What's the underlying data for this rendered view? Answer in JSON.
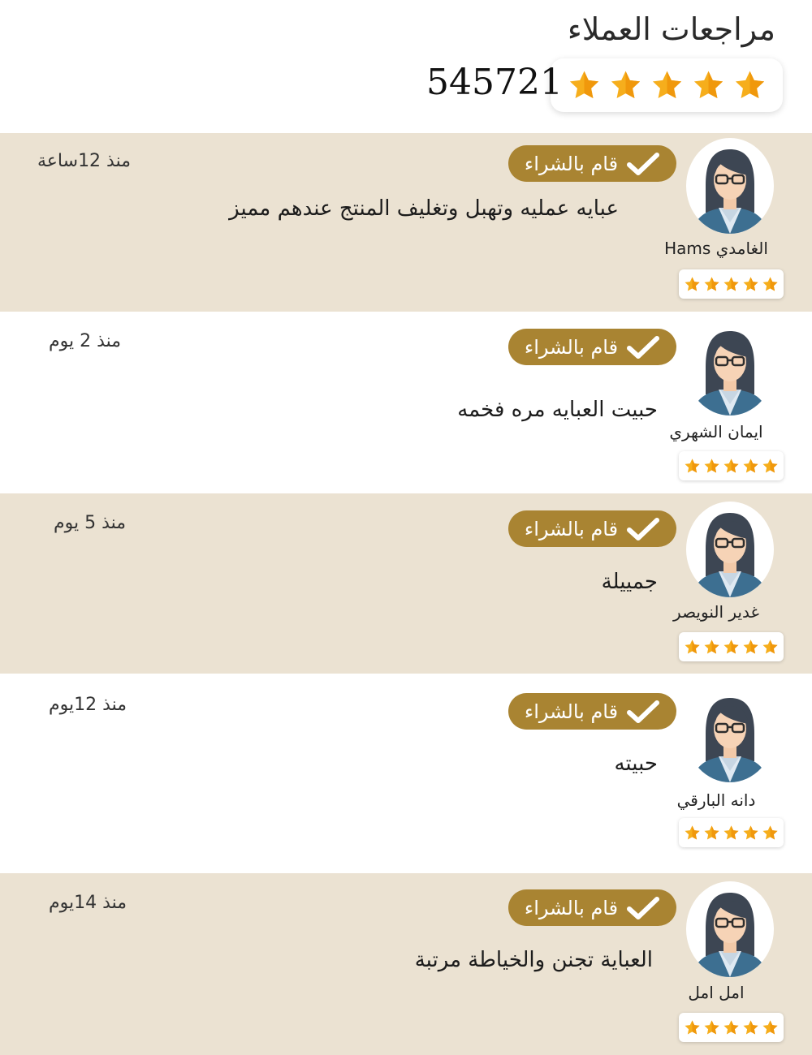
{
  "header": {
    "title": "مراجعات العملاء",
    "total_reviews": "545721",
    "overall_stars": 5
  },
  "colors": {
    "badge": "#a98432",
    "tint": "#ebe2d2",
    "star": "#f6ae1c"
  },
  "badge_label": "قام بالشراء",
  "reviews": [
    {
      "name": "الغامدي Hams",
      "text": "عبايه عمليه وتهبل وتغليف المنتج عندهم مميز",
      "time": "منذ 12ساعة",
      "stars": 5
    },
    {
      "name": "ايمان الشهري",
      "text": "حبيت العبايه مره فخمه",
      "time": "منذ 2 يوم",
      "stars": 5
    },
    {
      "name": "غدير النويصر",
      "text": "جمييلة",
      "time": "منذ 5 يوم",
      "stars": 5
    },
    {
      "name": "دانه البارقي",
      "text": "حبيته",
      "time": "منذ 12يوم",
      "stars": 5
    },
    {
      "name": "امل امل",
      "text": "العباية تجنن والخياطة مرتبة",
      "time": "منذ 14يوم",
      "stars": 5
    }
  ]
}
